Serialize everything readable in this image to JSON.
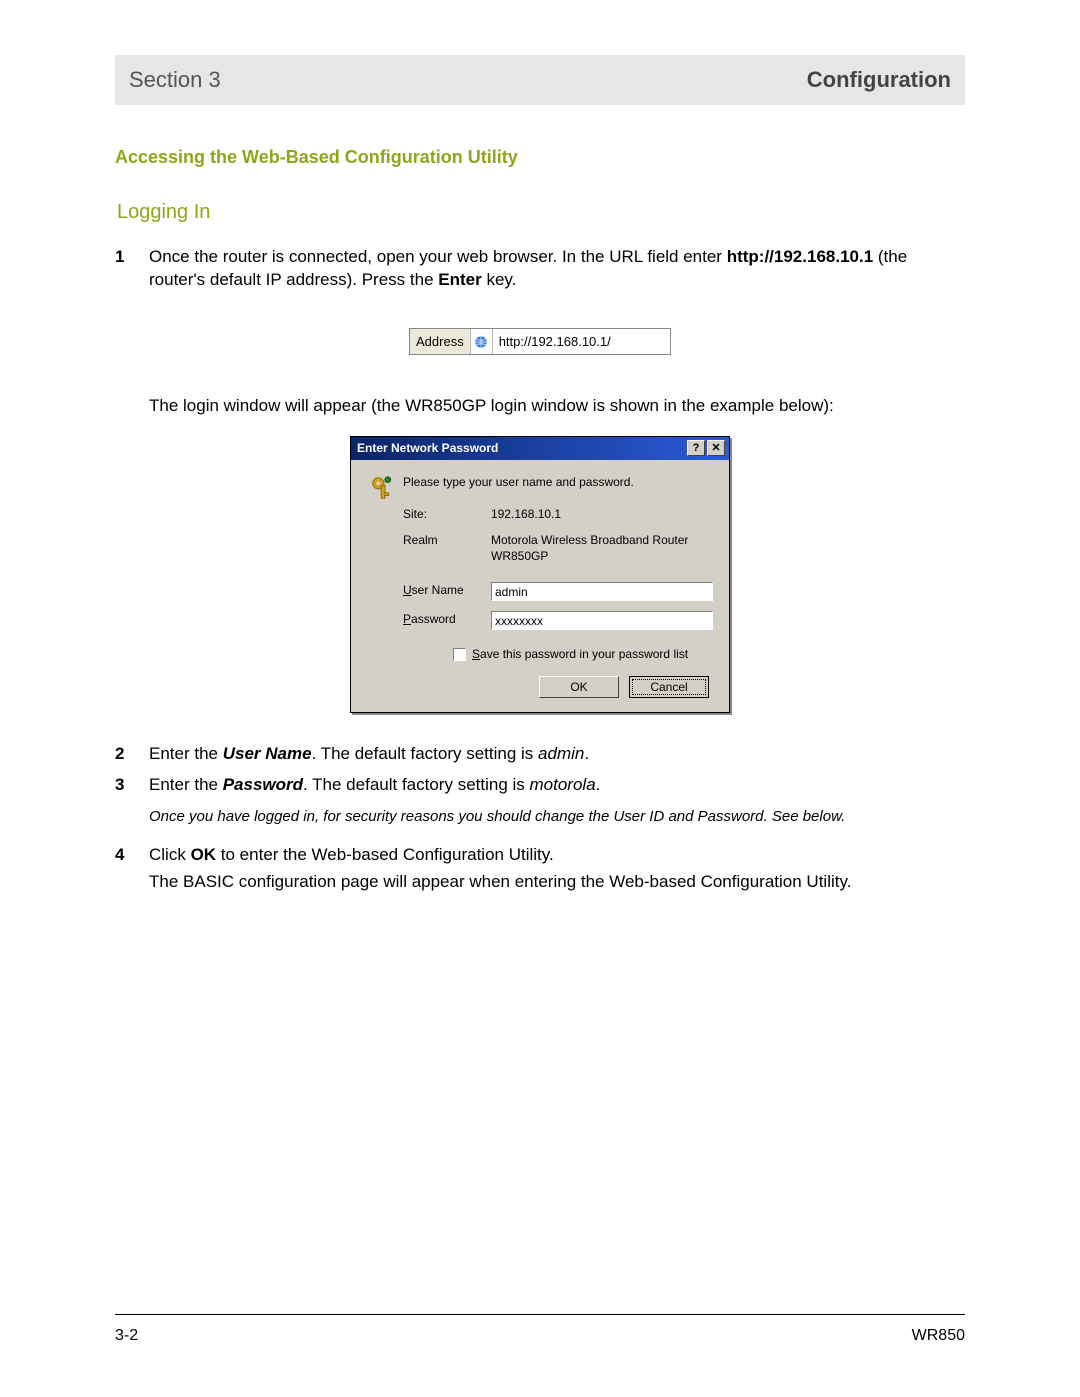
{
  "header": {
    "section_label": "Section 3",
    "title": "Configuration"
  },
  "headings": {
    "main": "Accessing the Web-Based Configuration Utility",
    "sub": "Logging In"
  },
  "step1": {
    "num": "1",
    "line_a_pre": "Once the router is connected, open your web browser. In the URL field enter ",
    "url_bold": "http://192.168.10.1",
    "line_a_mid": " (the router's default IP address). Press the ",
    "enter_bold": "Enter",
    "line_a_post": " key."
  },
  "address_bar": {
    "label": "Address",
    "url": "http://192.168.10.1/"
  },
  "step1_tail": "The login window will appear (the WR850GP login window is shown in the example below):",
  "dialog": {
    "title": "Enter Network Password",
    "prompt": "Please type your user name and password.",
    "site_label": "Site:",
    "site_value": "192.168.10.1",
    "realm_label": "Realm",
    "realm_value": "Motorola Wireless Broadband Router WR850GP",
    "user_label": "User Name",
    "user_value": "admin",
    "pass_label": "Password",
    "pass_value": "xxxxxxxx",
    "save_label": "Save this password in your password list",
    "ok": "OK",
    "cancel": "Cancel"
  },
  "step2": {
    "num": "2",
    "pre": "Enter the ",
    "bolditalic": "User Name",
    "mid": ". The default factory setting is ",
    "italic": "admin",
    "post": "."
  },
  "step3": {
    "num": "3",
    "pre": "Enter the ",
    "bolditalic": "Password",
    "mid": ". The default factory setting is ",
    "italic": "motorola",
    "post": "."
  },
  "note": "Once you have logged in, for security reasons you should change the User ID and Password. See below.",
  "step4": {
    "num": "4",
    "pre": "Click ",
    "bold": "OK",
    "post": " to enter the Web-based Configuration Utility.",
    "tail": "The BASIC configuration page will appear when entering the Web-based Configuration Utility."
  },
  "footer": {
    "page": "3-2",
    "model": "WR850"
  }
}
